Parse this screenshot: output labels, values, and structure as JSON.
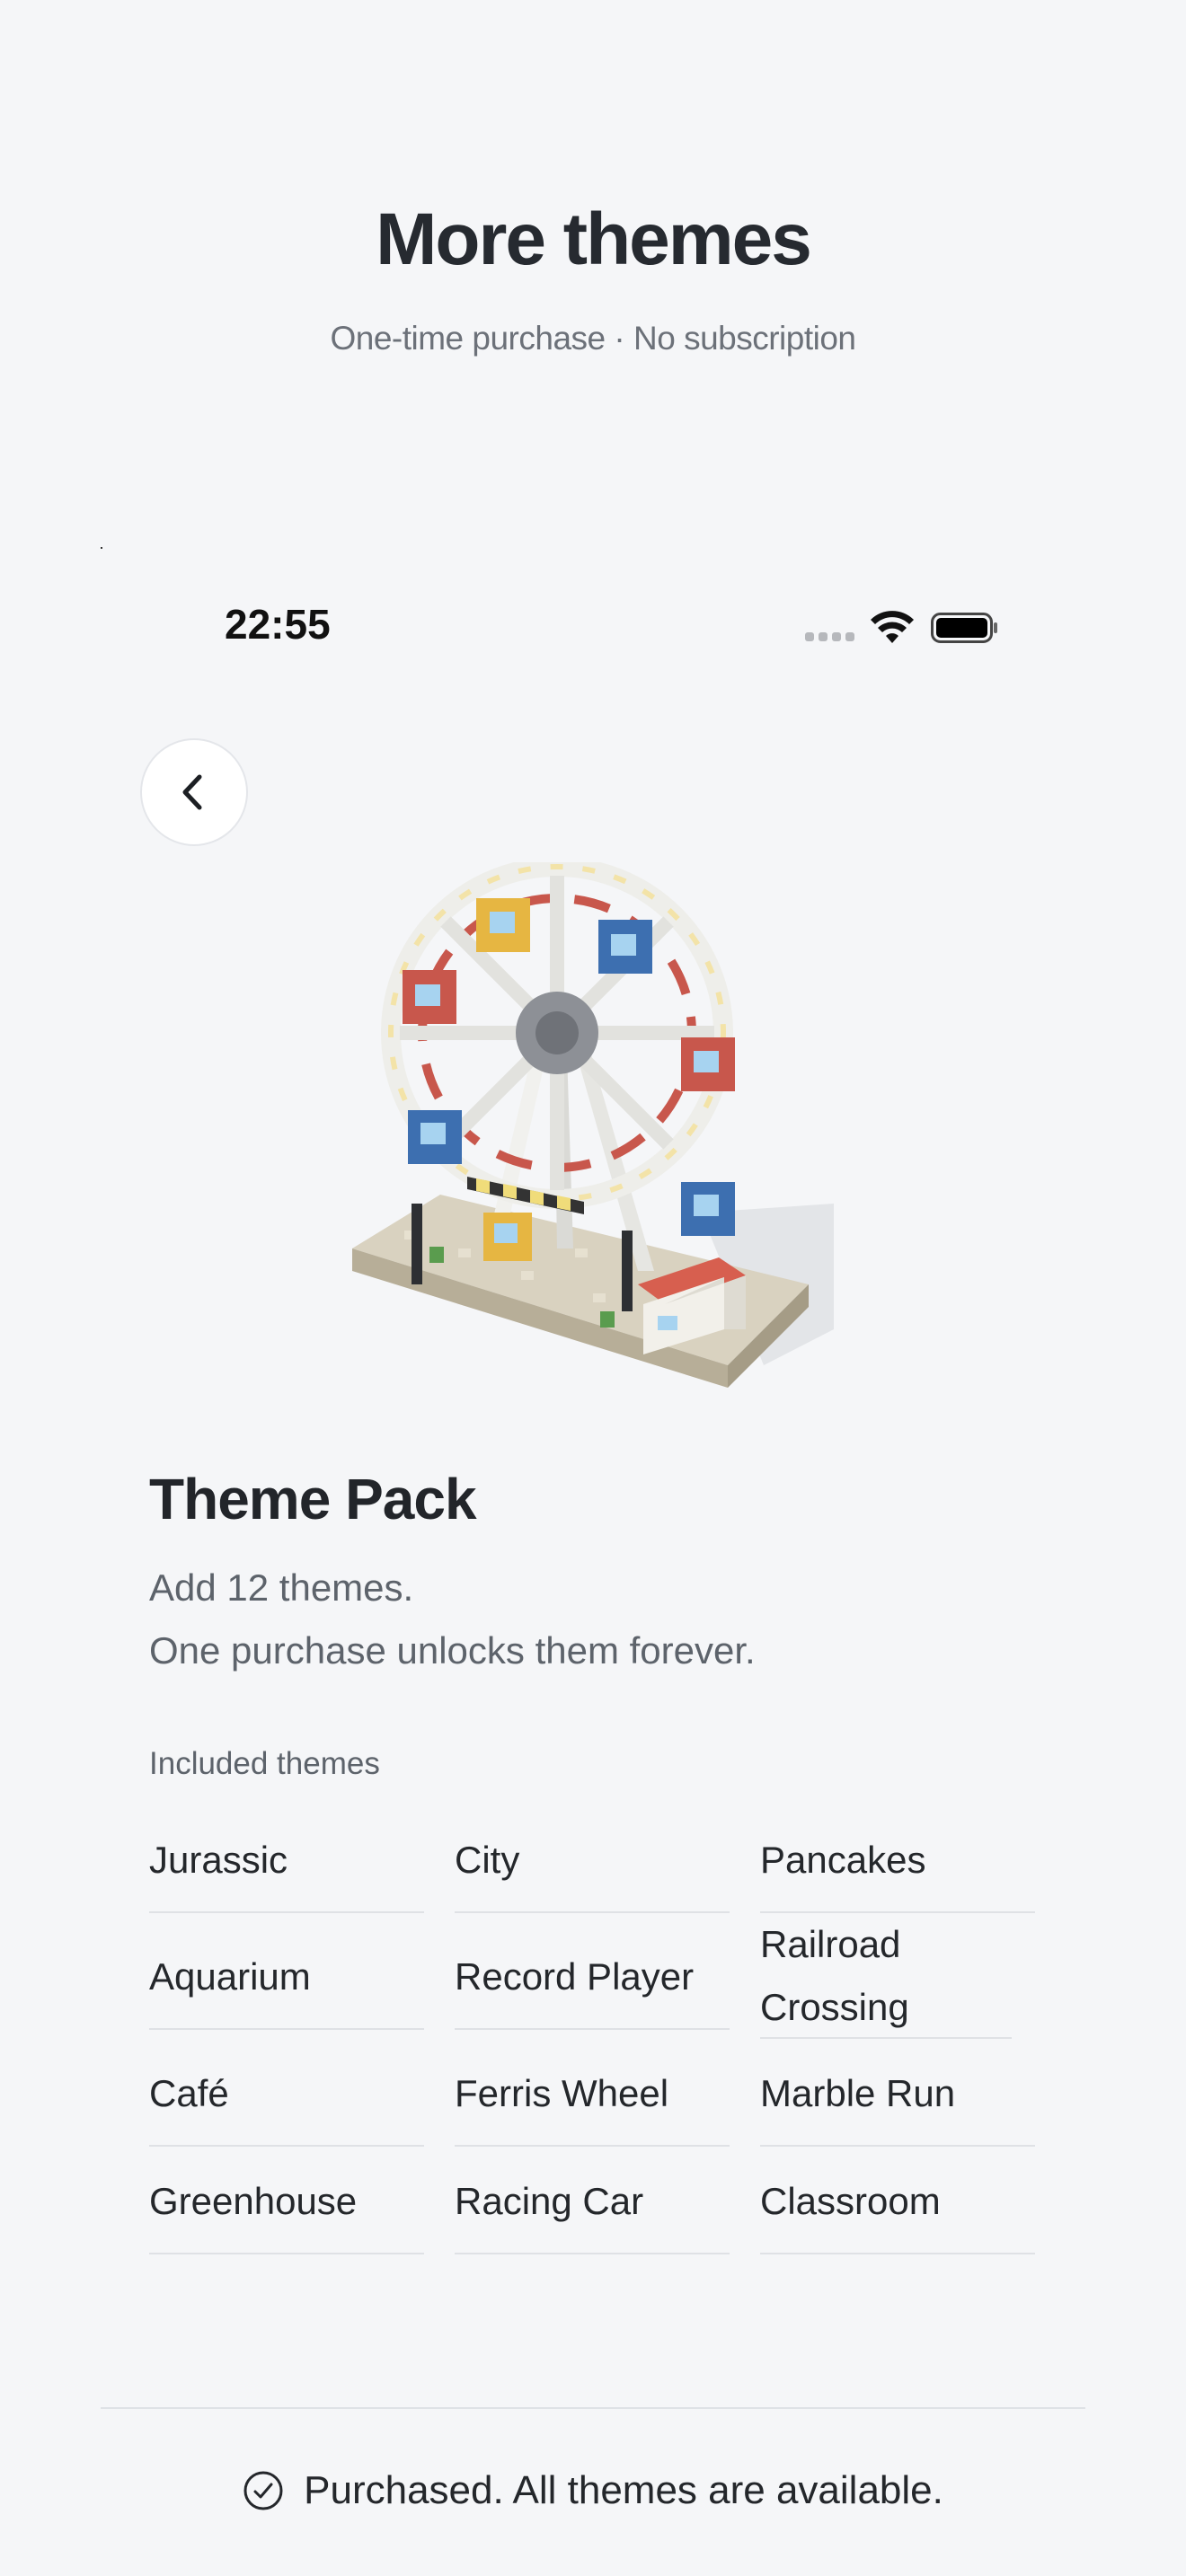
{
  "header": {
    "title": "More themes",
    "subtitle": "One-time purchase · No subscription"
  },
  "status_bar": {
    "time": "22:55",
    "icons": [
      "signal-icon",
      "wifi-icon",
      "battery-icon"
    ]
  },
  "nav": {
    "back_icon": "chevron-left-icon"
  },
  "illustration": {
    "subject": "ferris-wheel-voxel-model"
  },
  "pack": {
    "title": "Theme Pack",
    "description_line1": "Add 12 themes.",
    "description_line2": "One purchase unlocks them forever.",
    "included_label": "Included themes",
    "themes": [
      [
        "Jurassic",
        "City",
        "Pancakes"
      ],
      [
        "Aquarium",
        "Record Player",
        "Railroad Crossing"
      ],
      [
        "Café",
        "Ferris Wheel",
        "Marble Run"
      ],
      [
        "Greenhouse",
        "Racing Car",
        "Classroom"
      ]
    ]
  },
  "footer": {
    "status_text": "Purchased. All themes are available.",
    "status_icon": "check-circle-icon"
  },
  "colors": {
    "background": "#f5f6f8",
    "text_primary": "#24272b",
    "text_secondary": "#5d636b",
    "divider": "#dfe1e5"
  }
}
